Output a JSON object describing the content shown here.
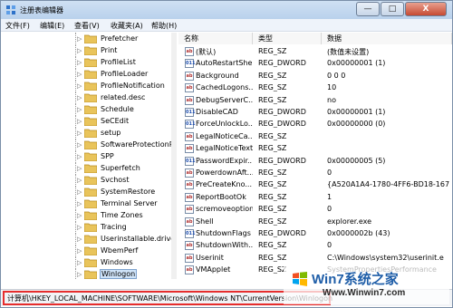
{
  "window": {
    "title": "注册表编辑器",
    "controls": [
      "—",
      "□",
      "X"
    ]
  },
  "menu": [
    "文件(F)",
    "编辑(E)",
    "查看(V)",
    "收藏夹(A)",
    "帮助(H)"
  ],
  "tree": {
    "items": [
      {
        "label": "Prefetcher"
      },
      {
        "label": "Print"
      },
      {
        "label": "ProfileList"
      },
      {
        "label": "ProfileLoader"
      },
      {
        "label": "ProfileNotification"
      },
      {
        "label": "related.desc"
      },
      {
        "label": "Schedule"
      },
      {
        "label": "SeCEdit"
      },
      {
        "label": "setup"
      },
      {
        "label": "SoftwareProtectionP"
      },
      {
        "label": "SPP"
      },
      {
        "label": "Superfetch"
      },
      {
        "label": "Svchost"
      },
      {
        "label": "SystemRestore"
      },
      {
        "label": "Terminal Server"
      },
      {
        "label": "Time Zones"
      },
      {
        "label": "Tracing"
      },
      {
        "label": "Userinstallable.drive"
      },
      {
        "label": "WbemPerf"
      },
      {
        "label": "Windows"
      },
      {
        "label": "Winlogon",
        "selected": true
      }
    ]
  },
  "values": {
    "columns": [
      "名称",
      "类型",
      "数据"
    ],
    "rows": [
      {
        "name": "(默认)",
        "type": "REG_SZ",
        "data": "(数值未设置)",
        "icon": "ab"
      },
      {
        "name": "AutoRestartShell",
        "type": "REG_DWORD",
        "data": "0x00000001 (1)",
        "icon": "dword"
      },
      {
        "name": "Background",
        "type": "REG_SZ",
        "data": "0 0 0",
        "icon": "ab"
      },
      {
        "name": "CachedLogons...",
        "type": "REG_SZ",
        "data": "10",
        "icon": "ab"
      },
      {
        "name": "DebugServerC...",
        "type": "REG_SZ",
        "data": "no",
        "icon": "ab"
      },
      {
        "name": "DisableCAD",
        "type": "REG_DWORD",
        "data": "0x00000001 (1)",
        "icon": "dword"
      },
      {
        "name": "ForceUnlockLo...",
        "type": "REG_DWORD",
        "data": "0x00000000 (0)",
        "icon": "dword"
      },
      {
        "name": "LegalNoticeCa...",
        "type": "REG_SZ",
        "data": "",
        "icon": "ab"
      },
      {
        "name": "LegalNoticeText",
        "type": "REG_SZ",
        "data": "",
        "icon": "ab"
      },
      {
        "name": "PasswordExpir...",
        "type": "REG_DWORD",
        "data": "0x00000005 (5)",
        "icon": "dword"
      },
      {
        "name": "PowerdownAft...",
        "type": "REG_SZ",
        "data": "0",
        "icon": "ab"
      },
      {
        "name": "PreCreateKno...",
        "type": "REG_SZ",
        "data": "{A520A1A4-1780-4FF6-BD18-167",
        "icon": "ab"
      },
      {
        "name": "ReportBootOk",
        "type": "REG_SZ",
        "data": "1",
        "icon": "ab"
      },
      {
        "name": "scremoveoption",
        "type": "REG_SZ",
        "data": "0",
        "icon": "ab"
      },
      {
        "name": "Shell",
        "type": "REG_SZ",
        "data": "explorer.exe",
        "icon": "ab"
      },
      {
        "name": "ShutdownFlags",
        "type": "REG_DWORD",
        "data": "0x0000002b (43)",
        "icon": "dword"
      },
      {
        "name": "ShutdownWith...",
        "type": "REG_SZ",
        "data": "0",
        "icon": "ab"
      },
      {
        "name": "Userinit",
        "type": "REG_SZ",
        "data": "C:\\Windows\\system32\\userinit.e",
        "icon": "ab"
      },
      {
        "name": "VMApplet",
        "type": "REG_SZ",
        "data": "SystemPropertiesPerformance",
        "icon": "ab"
      }
    ]
  },
  "status": {
    "path": "计算机\\HKEY_LOCAL_MACHINE\\SOFTWARE\\Microsoft\\Windows NT\\CurrentVersion\\Winlogon"
  },
  "watermark": {
    "title": "Win7系统之家",
    "url": "Www.Winwin7.com"
  }
}
